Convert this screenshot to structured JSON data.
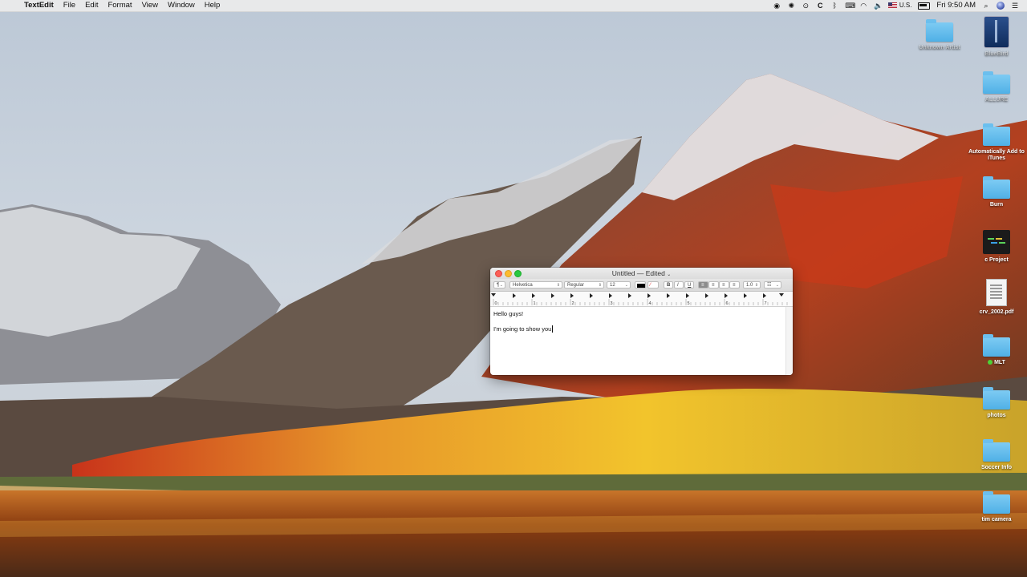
{
  "menubar": {
    "app_name": "TextEdit",
    "menus": [
      "File",
      "Edit",
      "Format",
      "View",
      "Window",
      "Help"
    ],
    "input_source": "U.S.",
    "clock": "Fri 9:50 AM"
  },
  "desktop": {
    "icons": [
      {
        "label": "Unknown Artist",
        "kind": "folder",
        "faded": true
      },
      {
        "label": "BlueBird",
        "kind": "drive",
        "faded": true
      },
      {
        "label": "ALLURE",
        "kind": "folder",
        "faded": true
      },
      {
        "label": "Automatically Add to iTunes",
        "kind": "folder",
        "faded": false
      },
      {
        "label": "Burn",
        "kind": "folder",
        "faded": false
      },
      {
        "label": "c Project",
        "kind": "project",
        "faded": false
      },
      {
        "label": "crv_2002.pdf",
        "kind": "pdf",
        "faded": false
      },
      {
        "label": "MLT",
        "kind": "folder",
        "faded": false,
        "tag": "green"
      },
      {
        "label": "photos",
        "kind": "folder",
        "faded": false
      },
      {
        "label": "Soccer Info",
        "kind": "folder",
        "faded": false
      },
      {
        "label": "tim camera",
        "kind": "folder",
        "faded": false
      }
    ]
  },
  "window": {
    "title": "Untitled — Edited",
    "toolbar": {
      "paragraph_style": "¶",
      "font_family": "Helvetica",
      "font_style": "Regular",
      "font_size": "12",
      "bold": "B",
      "italic": "I",
      "underline": "U",
      "line_spacing": "1.0"
    },
    "ruler_numbers": [
      "0",
      "1",
      "2",
      "3",
      "4",
      "5",
      "6",
      "7"
    ],
    "content": {
      "line1": "Hello guys!",
      "line2": "I'm going to show you"
    }
  },
  "colors": {
    "close": "#fc5f57",
    "minimize": "#fdbc2e",
    "maximize": "#28c840",
    "folder": "#5db8ea"
  }
}
